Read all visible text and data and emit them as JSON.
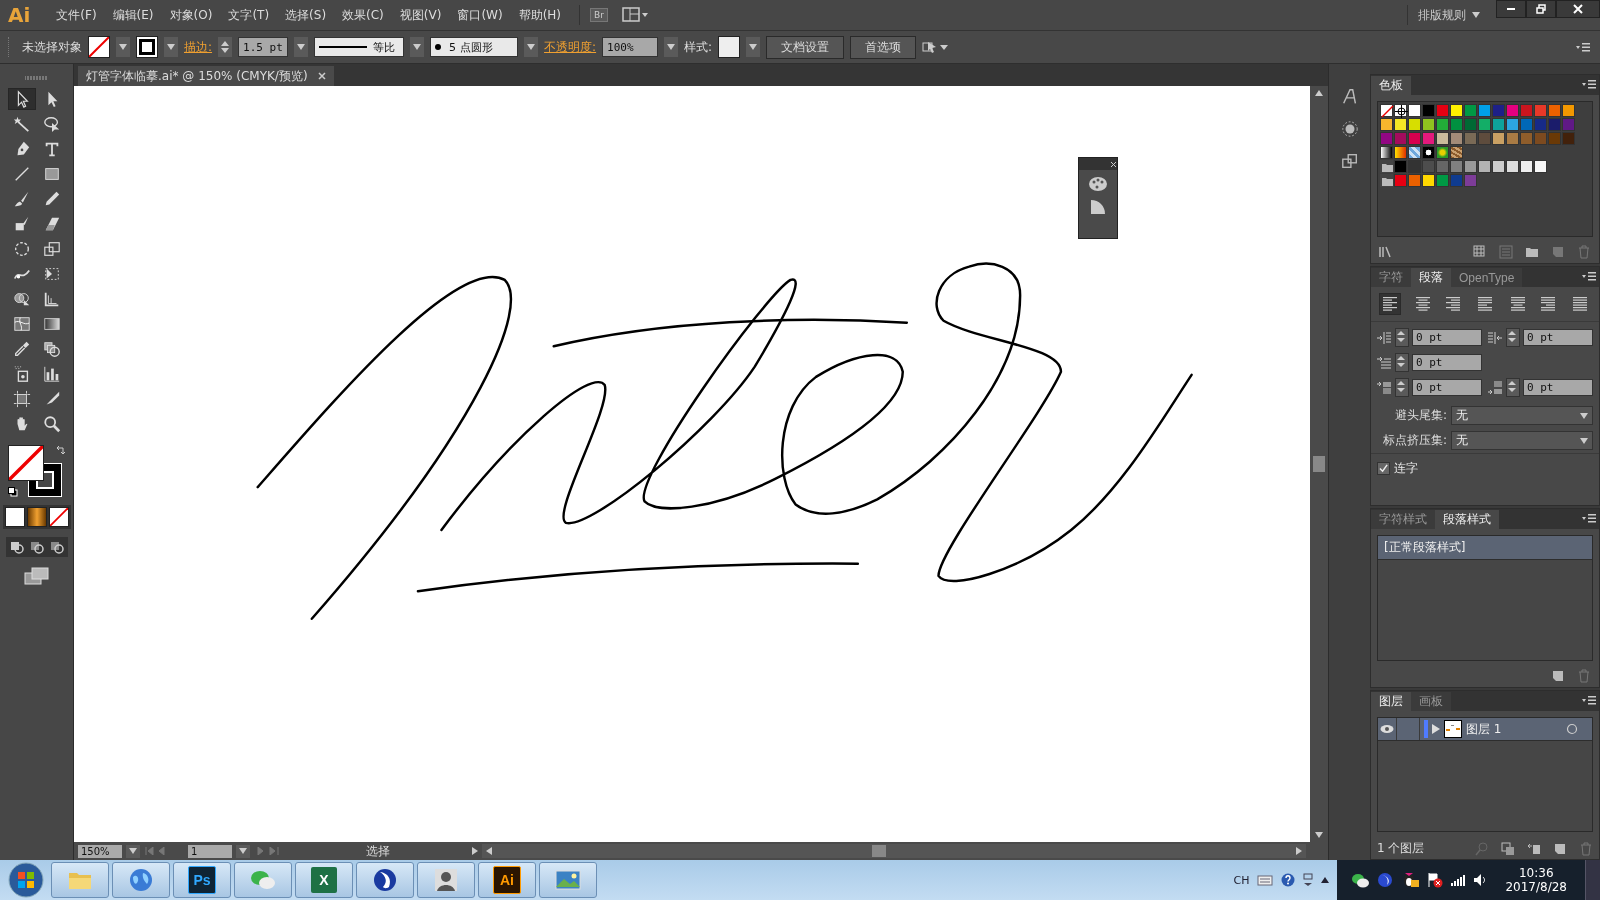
{
  "menu_bar": {
    "logo": "Ai",
    "menus": [
      "文件(F)",
      "编辑(E)",
      "对象(O)",
      "文字(T)",
      "选择(S)",
      "效果(C)",
      "视图(V)",
      "窗口(W)",
      "帮助(H)"
    ],
    "bridge_button": "Br",
    "workspace": "排版规则"
  },
  "control_bar": {
    "selection": "未选择对象",
    "fill": {
      "kind": "none"
    },
    "stroke": {
      "color": "#000000"
    },
    "stroke_label": "描边:",
    "stroke_weight": "1.5 pt",
    "stroke_profile": "等比",
    "brush": "5 点圆形",
    "opacity_label": "不透明度:",
    "opacity": "100%",
    "style_label": "样式:",
    "buttons": [
      "文档设置",
      "首选项"
    ]
  },
  "tools": {
    "items": [
      {
        "kind": "selection",
        "selected": true
      },
      {
        "kind": "direct-selection",
        "selected": false
      },
      {
        "kind": "magic-wand",
        "selected": false
      },
      {
        "kind": "lasso",
        "selected": false
      },
      {
        "kind": "pen",
        "selected": false
      },
      {
        "kind": "type",
        "selected": false
      },
      {
        "kind": "line",
        "selected": false
      },
      {
        "kind": "rectangle",
        "selected": false
      },
      {
        "kind": "brush",
        "selected": false
      },
      {
        "kind": "pencil",
        "selected": false
      },
      {
        "kind": "blob-brush",
        "selected": false
      },
      {
        "kind": "eraser",
        "selected": false
      },
      {
        "kind": "rotate",
        "selected": false
      },
      {
        "kind": "scale",
        "selected": false
      },
      {
        "kind": "warp",
        "selected": false
      },
      {
        "kind": "free-transform",
        "selected": false
      },
      {
        "kind": "shape-builder",
        "selected": false
      },
      {
        "kind": "perspective-grid",
        "selected": false
      },
      {
        "kind": "mesh",
        "selected": false
      },
      {
        "kind": "gradient",
        "selected": false
      },
      {
        "kind": "eyedropper",
        "selected": false
      },
      {
        "kind": "blend",
        "selected": false
      },
      {
        "kind": "symbol-sprayer",
        "selected": false
      },
      {
        "kind": "column-graph",
        "selected": false
      },
      {
        "kind": "artboard",
        "selected": false
      },
      {
        "kind": "slice",
        "selected": false
      },
      {
        "kind": "hand",
        "selected": false
      },
      {
        "kind": "zoom",
        "selected": false
      }
    ],
    "fill": {
      "kind": "none"
    },
    "stroke": {
      "color": "#000000"
    }
  },
  "document_tab": {
    "title": "灯管字体临摹.ai* @ 150% (CMYK/预览)"
  },
  "status_bar": {
    "zoom": "150%",
    "artboard": "1",
    "tool": "选择"
  },
  "swatches": {
    "tab": "色板",
    "rows": [
      [
        {
          "kind": "none"
        },
        {
          "kind": "registration"
        },
        {
          "color": "#ffffff"
        },
        {
          "color": "#000000"
        },
        {
          "color": "#e60012"
        },
        {
          "color": "#fff100"
        },
        {
          "color": "#009944"
        },
        {
          "color": "#00a0e9"
        },
        {
          "color": "#1d2088"
        },
        {
          "color": "#e4007f"
        },
        {
          "color": "#c9151e"
        },
        {
          "color": "#e83828"
        },
        {
          "color": "#eb6100"
        },
        {
          "color": "#f39800"
        }
      ],
      [
        {
          "color": "#f8b62d"
        },
        {
          "color": "#f5e625"
        },
        {
          "color": "#d7de00"
        },
        {
          "color": "#8fc31f"
        },
        {
          "color": "#22ac38"
        },
        {
          "color": "#009140"
        },
        {
          "color": "#006934"
        },
        {
          "color": "#13ae67"
        },
        {
          "color": "#0ea29b"
        },
        {
          "color": "#2ca6e0"
        },
        {
          "color": "#0068b7"
        },
        {
          "color": "#172a88"
        },
        {
          "color": "#1b1c6b"
        },
        {
          "color": "#601986"
        }
      ],
      [
        {
          "color": "#920783"
        },
        {
          "color": "#a40b5d"
        },
        {
          "color": "#d7004e"
        },
        {
          "color": "#e4197c"
        },
        {
          "color": "#c9bc9c"
        },
        {
          "color": "#a38b78"
        },
        {
          "color": "#7a6a56"
        },
        {
          "color": "#5e4c3d"
        },
        {
          "color": "#c9a063"
        },
        {
          "color": "#a97b44"
        },
        {
          "color": "#8f5d2b"
        },
        {
          "color": "#7c4a1f"
        },
        {
          "color": "#6a3906"
        },
        {
          "color": "#42210b"
        }
      ],
      [
        {
          "kind": "gradient-gray"
        },
        {
          "kind": "gradient-orange"
        },
        {
          "kind": "pattern-checker"
        },
        {
          "kind": "pattern-dots"
        },
        {
          "kind": "pattern-green"
        },
        {
          "kind": "pattern-brown"
        }
      ],
      [
        {
          "kind": "folder"
        },
        {
          "color": "#000000"
        },
        {
          "color": "#333333"
        },
        {
          "color": "#4d4d4d"
        },
        {
          "color": "#666666"
        },
        {
          "color": "#808080"
        },
        {
          "color": "#999999"
        },
        {
          "color": "#b3b3b3"
        },
        {
          "color": "#cccccc"
        },
        {
          "color": "#dddddd"
        },
        {
          "color": "#eeeeee"
        },
        {
          "color": "#f7f7f7"
        }
      ],
      [
        {
          "kind": "folder"
        },
        {
          "color": "#e60012"
        },
        {
          "color": "#eb6100"
        },
        {
          "color": "#ffd800"
        },
        {
          "color": "#009944"
        },
        {
          "color": "#0f3b8f"
        },
        {
          "color": "#7d3c98"
        }
      ]
    ]
  },
  "paragraph": {
    "tabs": [
      {
        "label": "字符",
        "selected": false
      },
      {
        "label": "段落",
        "selected": true
      },
      {
        "label": "OpenType",
        "selected": false
      }
    ],
    "alignments": [
      {
        "kind": "left",
        "selected": true
      },
      {
        "kind": "center",
        "selected": false
      },
      {
        "kind": "right",
        "selected": false
      },
      {
        "kind": "justify-left",
        "selected": false
      },
      {
        "kind": "justify-center",
        "selected": false
      },
      {
        "kind": "justify-right",
        "selected": false
      },
      {
        "kind": "justify-all",
        "selected": false
      }
    ],
    "fields": [
      {
        "kind": "left-indent",
        "value": "0 pt"
      },
      {
        "kind": "right-indent",
        "value": "0 pt"
      },
      {
        "kind": "first-line-indent",
        "value": "0 pt"
      },
      {
        "kind": "space-before",
        "value": "0 pt"
      },
      {
        "kind": "space-after",
        "value": "0 pt"
      }
    ],
    "kinsoku": {
      "label": "避头尾集:",
      "value": "无"
    },
    "mojikumi": {
      "label": "标点挤压集:",
      "value": "无"
    },
    "hyphenation": {
      "label": "连字",
      "checked": true
    }
  },
  "paragraph_styles": {
    "tabs": [
      {
        "label": "字符样式",
        "selected": false
      },
      {
        "label": "段落样式",
        "selected": true
      }
    ],
    "items": [
      {
        "label": "[正常段落样式]",
        "selected": true
      }
    ]
  },
  "layers": {
    "tabs": [
      {
        "label": "图层",
        "selected": true
      },
      {
        "label": "画板",
        "selected": false
      }
    ],
    "items": [
      {
        "name": "图层 1",
        "visible": true,
        "selected": true,
        "color": "#4f7bff"
      }
    ],
    "count": "1 个图层"
  },
  "taskbar": {
    "apps": [
      {
        "kind": "explorer"
      },
      {
        "kind": "browser"
      },
      {
        "kind": "photoshop",
        "label": "Ps"
      },
      {
        "kind": "wechat"
      },
      {
        "kind": "excel",
        "label": "X"
      },
      {
        "kind": "player"
      },
      {
        "kind": "person"
      },
      {
        "kind": "illustrator",
        "label": "Ai"
      },
      {
        "kind": "photos"
      }
    ],
    "language": "CH",
    "time": "10:36",
    "date": "2017/8/28"
  }
}
